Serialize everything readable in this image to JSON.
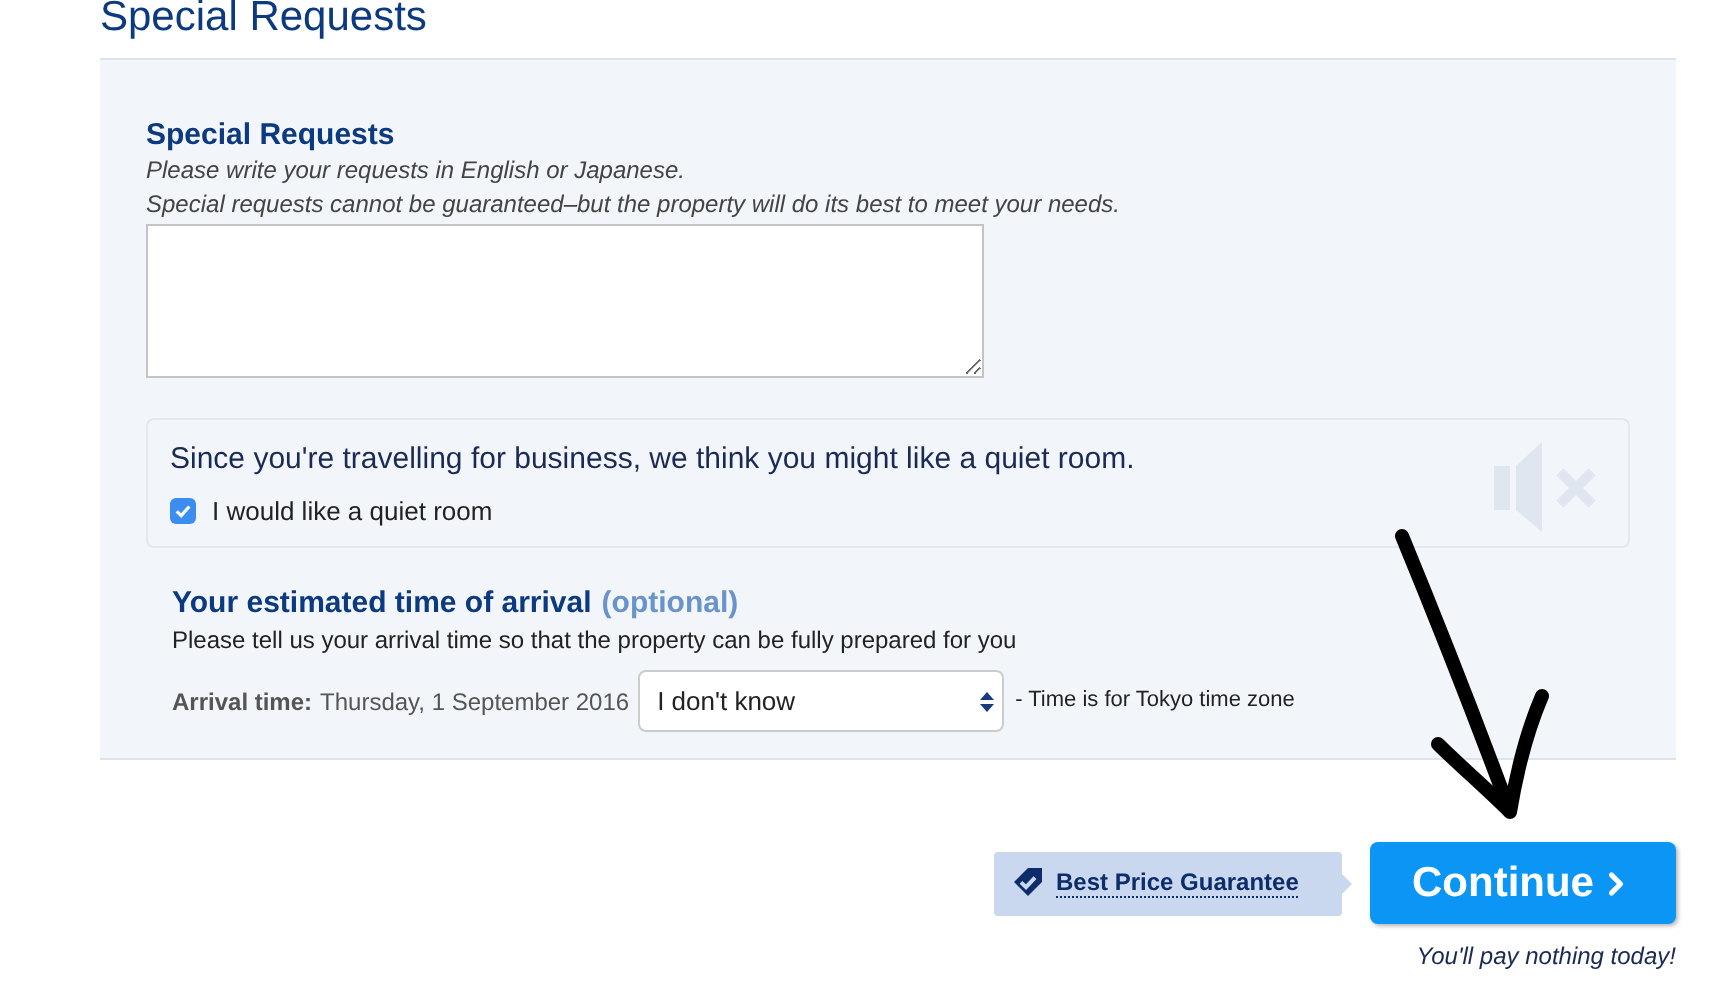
{
  "page_title": "Special Requests",
  "special_requests": {
    "heading": "Special Requests",
    "hint_lines": [
      "Please write your requests in English or Japanese.",
      "Special requests cannot be guaranteed–but the property will do its best to meet your needs."
    ]
  },
  "quiet_room": {
    "message": "Since you're travelling for business, we think you might like a quiet room.",
    "checkbox_label": "I would like a quiet room",
    "checked": true
  },
  "arrival": {
    "heading": "Your estimated time of arrival",
    "optional": "(optional)",
    "description": "Please tell us your arrival time so that the property can be fully prepared for you",
    "label": "Arrival time:",
    "date": "Thursday, 1 September 2016",
    "select_value": "I don't know",
    "note": "- Time is for Tokyo time zone"
  },
  "best_price": "Best Price Guarantee",
  "continue_button": "Continue",
  "pay_note": "You'll pay nothing today!"
}
